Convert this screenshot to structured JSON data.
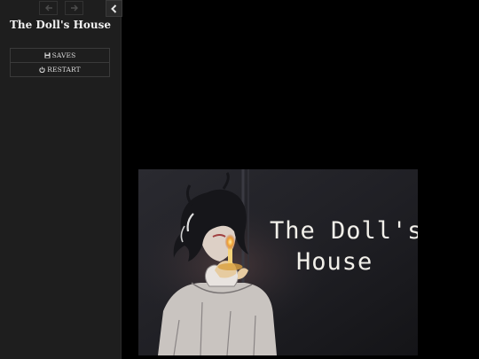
{
  "sidebar": {
    "title": "The Doll's House",
    "menu": [
      {
        "label": "SAVES",
        "icon": "floppy-disk-icon"
      },
      {
        "label": "RESTART",
        "icon": "power-icon"
      }
    ],
    "nav_back_icon": "arrow-left-icon",
    "nav_forward_icon": "arrow-right-icon",
    "collapse_icon": "chevron-left-icon"
  },
  "passage": {
    "image_text_line1": "The Doll's",
    "image_text_line2": "House"
  },
  "colors": {
    "sidebar_bg": "#1e1e1e",
    "passage_bg": "#000000",
    "title_text": "#f0f0f0",
    "image_text": "#f2f0ea"
  }
}
